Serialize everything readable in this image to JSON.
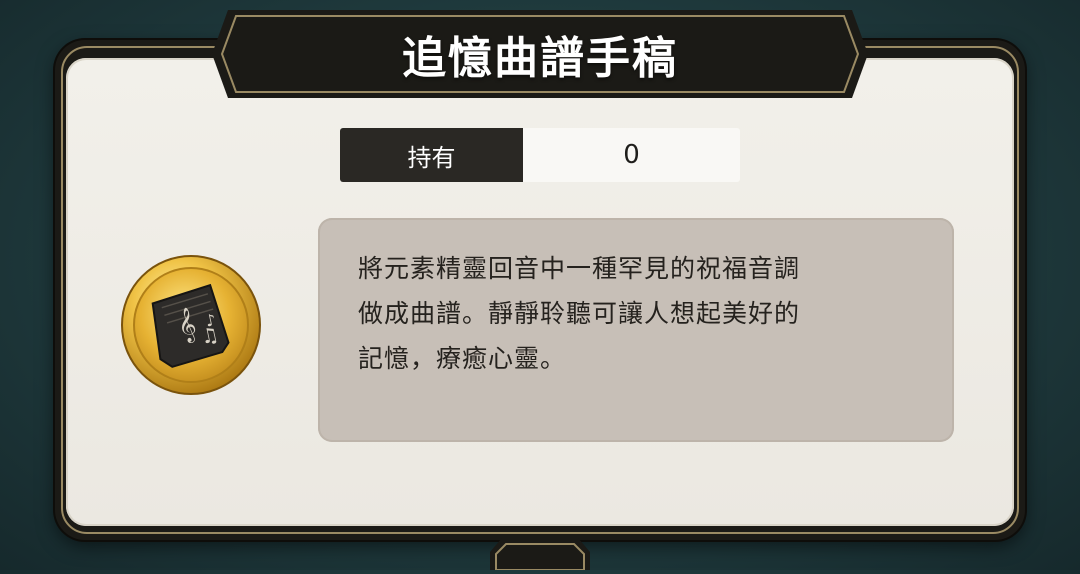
{
  "dialog": {
    "title": "追憶曲譜手稿",
    "holding": {
      "label": "持有",
      "value": "0"
    },
    "item": {
      "icon": "sheet-music-icon",
      "description": "將元素精靈回音中一種罕見的祝福音調\n做成曲譜。靜靜聆聽可讓人想起美好的\n記憶，療癒心靈。"
    }
  },
  "colors": {
    "background": "#1f3a3d",
    "frame": "#1b1a16",
    "frame_trim": "#9a8a63",
    "panel": "#efece6",
    "description_box": "#c7bfb7",
    "medallion_gold": "#e8b43a"
  }
}
